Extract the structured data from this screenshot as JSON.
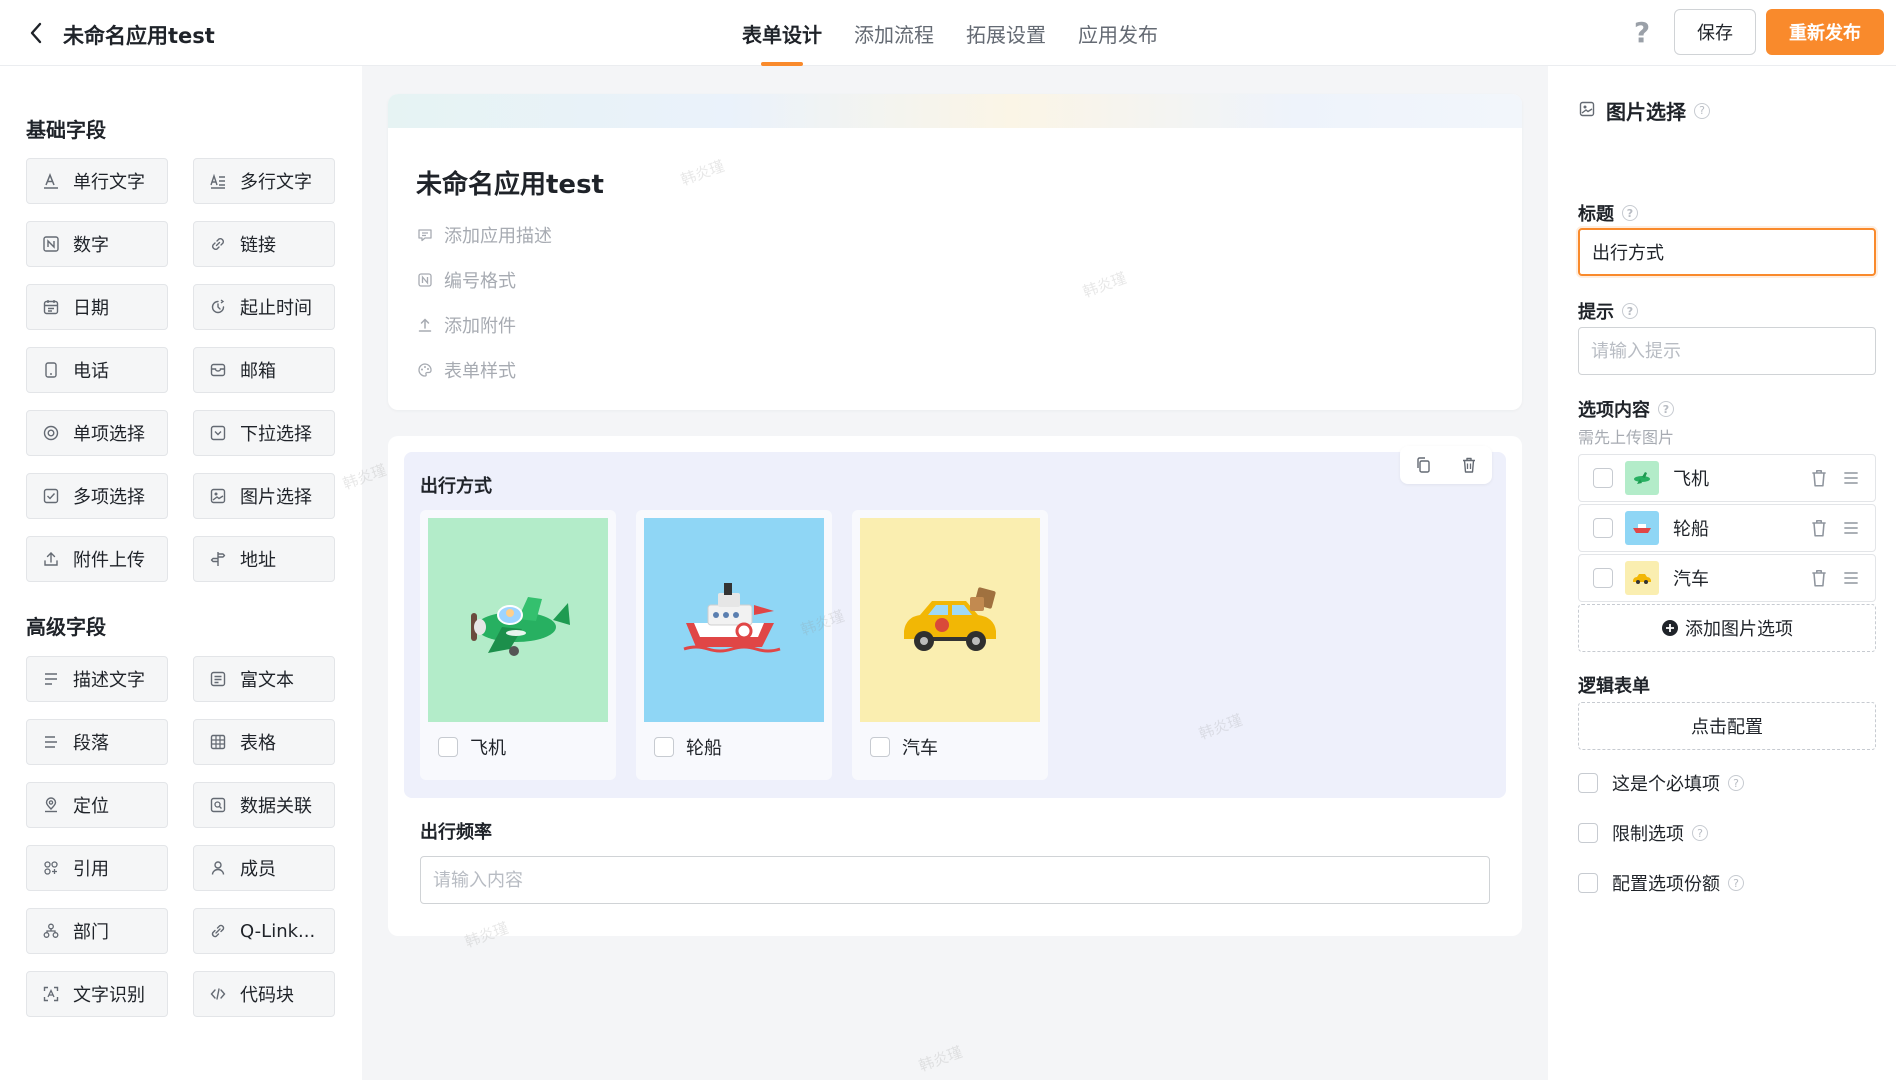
{
  "topbar": {
    "app_title": "未命名应用test",
    "tabs": [
      {
        "label": "表单设计",
        "active": true
      },
      {
        "label": "添加流程",
        "active": false
      },
      {
        "label": "拓展设置",
        "active": false
      },
      {
        "label": "应用发布",
        "active": false
      }
    ],
    "help_glyph": "?",
    "save_label": "保存",
    "publish_label": "重新发布",
    "accent_color": "#f98a2c"
  },
  "left": {
    "basic_title": "基础字段",
    "advanced_title": "高级字段",
    "basic": [
      {
        "label": "单行文字",
        "icon": "text-a-icon"
      },
      {
        "label": "多行文字",
        "icon": "multiline-text-icon"
      },
      {
        "label": "数字",
        "icon": "number-icon"
      },
      {
        "label": "链接",
        "icon": "link-icon"
      },
      {
        "label": "日期",
        "icon": "calendar-icon"
      },
      {
        "label": "起止时间",
        "icon": "time-range-icon"
      },
      {
        "label": "电话",
        "icon": "phone-icon"
      },
      {
        "label": "邮箱",
        "icon": "mail-icon"
      },
      {
        "label": "单项选择",
        "icon": "radio-icon"
      },
      {
        "label": "下拉选择",
        "icon": "dropdown-icon"
      },
      {
        "label": "多项选择",
        "icon": "checkbox-icon"
      },
      {
        "label": "图片选择",
        "icon": "image-icon"
      },
      {
        "label": "附件上传",
        "icon": "upload-icon"
      },
      {
        "label": "地址",
        "icon": "address-icon"
      }
    ],
    "advanced": [
      {
        "label": "描述文字",
        "icon": "description-icon"
      },
      {
        "label": "富文本",
        "icon": "rich-text-icon"
      },
      {
        "label": "段落",
        "icon": "paragraph-icon"
      },
      {
        "label": "表格",
        "icon": "table-icon"
      },
      {
        "label": "定位",
        "icon": "location-icon"
      },
      {
        "label": "数据关联",
        "icon": "data-link-icon"
      },
      {
        "label": "引用",
        "icon": "reference-icon"
      },
      {
        "label": "成员",
        "icon": "member-icon"
      },
      {
        "label": "部门",
        "icon": "department-icon"
      },
      {
        "label": "Q-Link...",
        "icon": "q-link-icon"
      },
      {
        "label": "文字识别",
        "icon": "ocr-icon"
      },
      {
        "label": "代码块",
        "icon": "code-icon"
      }
    ]
  },
  "canvas": {
    "form_title": "未命名应用test",
    "meta": [
      {
        "label": "添加应用描述",
        "icon": "comment-icon"
      },
      {
        "label": "编号格式",
        "icon": "number-format-icon"
      },
      {
        "label": "添加附件",
        "icon": "attachment-upload-icon"
      },
      {
        "label": "表单样式",
        "icon": "palette-icon"
      }
    ],
    "field1": {
      "label": "出行方式",
      "options": [
        {
          "label": "飞机",
          "bg": "#b3ecc9",
          "icon": "airplane-icon"
        },
        {
          "label": "轮船",
          "bg": "#8fd6f5",
          "icon": "ship-icon"
        },
        {
          "label": "汽车",
          "bg": "#faeeb0",
          "icon": "car-icon"
        }
      ]
    },
    "field2": {
      "label": "出行频率",
      "placeholder": "请输入内容"
    },
    "watermark": "韩炎瑾"
  },
  "right": {
    "title": "图片选择",
    "title_label": "标题",
    "title_value": "出行方式",
    "hint_label": "提示",
    "hint_placeholder": "请输入提示",
    "options_label": "选项内容",
    "options_sub": "需先上传图片",
    "options": [
      {
        "label": "飞机",
        "bg": "#b3ecc9"
      },
      {
        "label": "轮船",
        "bg": "#8fd6f5"
      },
      {
        "label": "汽车",
        "bg": "#faeeb0"
      }
    ],
    "add_option_label": "添加图片选项",
    "logic_label": "逻辑表单",
    "logic_button": "点击配置",
    "checks": [
      {
        "label": "这是个必填项"
      },
      {
        "label": "限制选项"
      },
      {
        "label": "配置选项份额"
      }
    ]
  }
}
